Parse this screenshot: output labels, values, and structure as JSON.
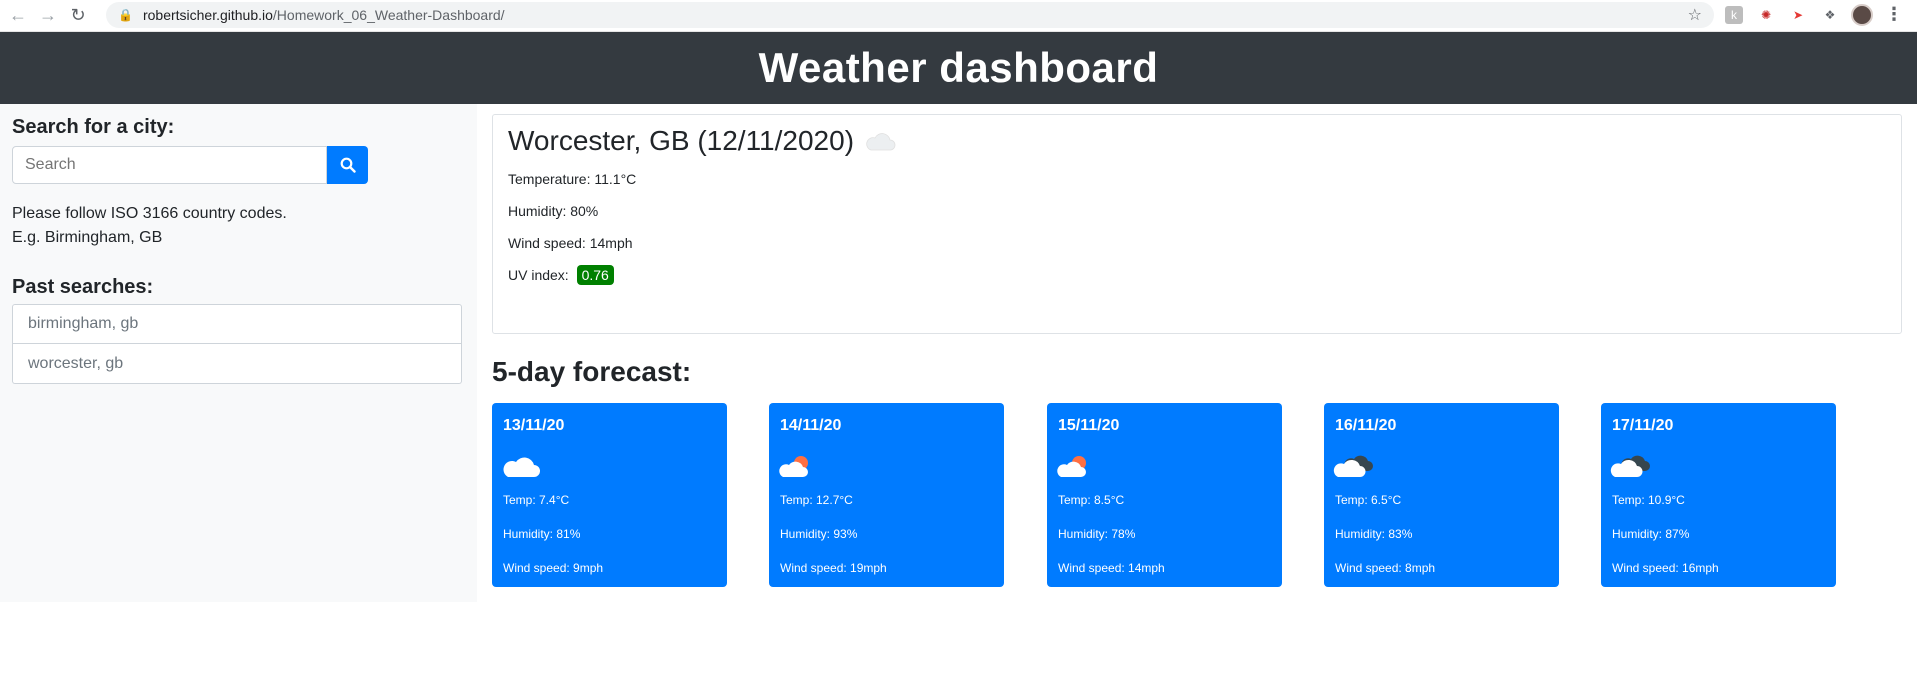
{
  "browser": {
    "url_host": "robertsicher.github.io",
    "url_path": "/Homework_06_Weather-Dashboard/"
  },
  "header": {
    "title": "Weather dashboard"
  },
  "sidebar": {
    "search_title": "Search for a city:",
    "search_placeholder": "Search",
    "note_line1": "Please follow ISO 3166 country codes.",
    "note_line2": "E.g. Birmingham, GB",
    "past_title": "Past searches:",
    "past_searches": [
      "birmingham, gb",
      "worcester, gb"
    ]
  },
  "current": {
    "title": "Worcester, GB (12/11/2020)",
    "icon": "cloud-icon",
    "temperature": "Temperature: 11.1°C",
    "humidity": "Humidity: 80%",
    "wind": "Wind speed: 14mph",
    "uv_label": "UV index:",
    "uv_value": "0.76",
    "uv_color": "#008000"
  },
  "forecast": {
    "title": "5-day forecast:",
    "days": [
      {
        "date": "13/11/20",
        "icon": "cloud-icon",
        "temp": "Temp: 7.4°C",
        "humidity": "Humidity: 81%",
        "wind": "Wind speed: 9mph"
      },
      {
        "date": "14/11/20",
        "icon": "sun-cloud-icon",
        "temp": "Temp: 12.7°C",
        "humidity": "Humidity: 93%",
        "wind": "Wind speed: 19mph"
      },
      {
        "date": "15/11/20",
        "icon": "sun-cloud-icon",
        "temp": "Temp: 8.5°C",
        "humidity": "Humidity: 78%",
        "wind": "Wind speed: 14mph"
      },
      {
        "date": "16/11/20",
        "icon": "broken-clouds-icon",
        "temp": "Temp: 6.5°C",
        "humidity": "Humidity: 83%",
        "wind": "Wind speed: 8mph"
      },
      {
        "date": "17/11/20",
        "icon": "broken-clouds-icon",
        "temp": "Temp: 10.9°C",
        "humidity": "Humidity: 87%",
        "wind": "Wind speed: 16mph"
      }
    ]
  },
  "colors": {
    "header_bg": "#343a40",
    "accent": "#007bff",
    "sidebar_bg": "#f8f9fa"
  }
}
